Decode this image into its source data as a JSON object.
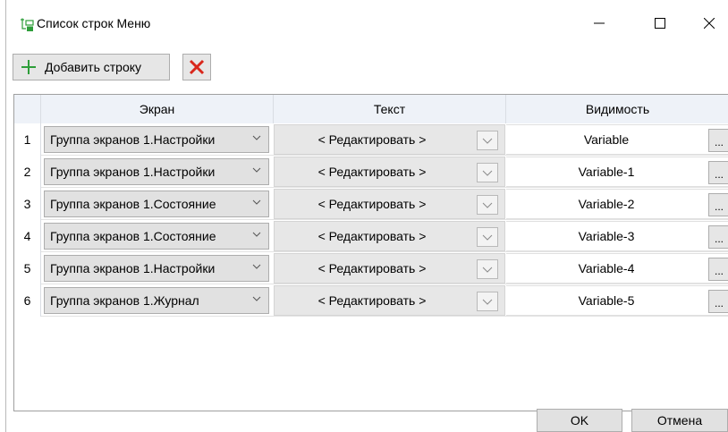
{
  "window": {
    "title": "Список строк Меню",
    "icon": "menu-rows-icon"
  },
  "toolbar": {
    "add_label": "Добавить строку",
    "add_icon": "plus-icon",
    "delete_icon": "red-x-icon",
    "accent_green": "#2e9e3a",
    "accent_red": "#d9271c"
  },
  "grid": {
    "columns": [
      "Экран",
      "Текст",
      "Видимость"
    ],
    "rows": [
      {
        "num": "1",
        "screen": "Группа экранов 1.Настройки",
        "text": "< Редактировать >",
        "visibility": "Variable"
      },
      {
        "num": "2",
        "screen": "Группа экранов 1.Настройки",
        "text": "< Редактировать >",
        "visibility": "Variable-1"
      },
      {
        "num": "3",
        "screen": "Группа экранов 1.Состояние",
        "text": "< Редактировать >",
        "visibility": "Variable-2"
      },
      {
        "num": "4",
        "screen": "Группа экранов 1.Состояние",
        "text": "< Редактировать >",
        "visibility": "Variable-3"
      },
      {
        "num": "5",
        "screen": "Группа экранов 1.Настройки",
        "text": "< Редактировать >",
        "visibility": "Variable-4"
      },
      {
        "num": "6",
        "screen": "Группа экранов 1.Журнал",
        "text": "< Редактировать >",
        "visibility": "Variable-5"
      }
    ],
    "ellipsis": "..."
  },
  "footer": {
    "ok_label": "OK",
    "cancel_label": "Отмена"
  }
}
